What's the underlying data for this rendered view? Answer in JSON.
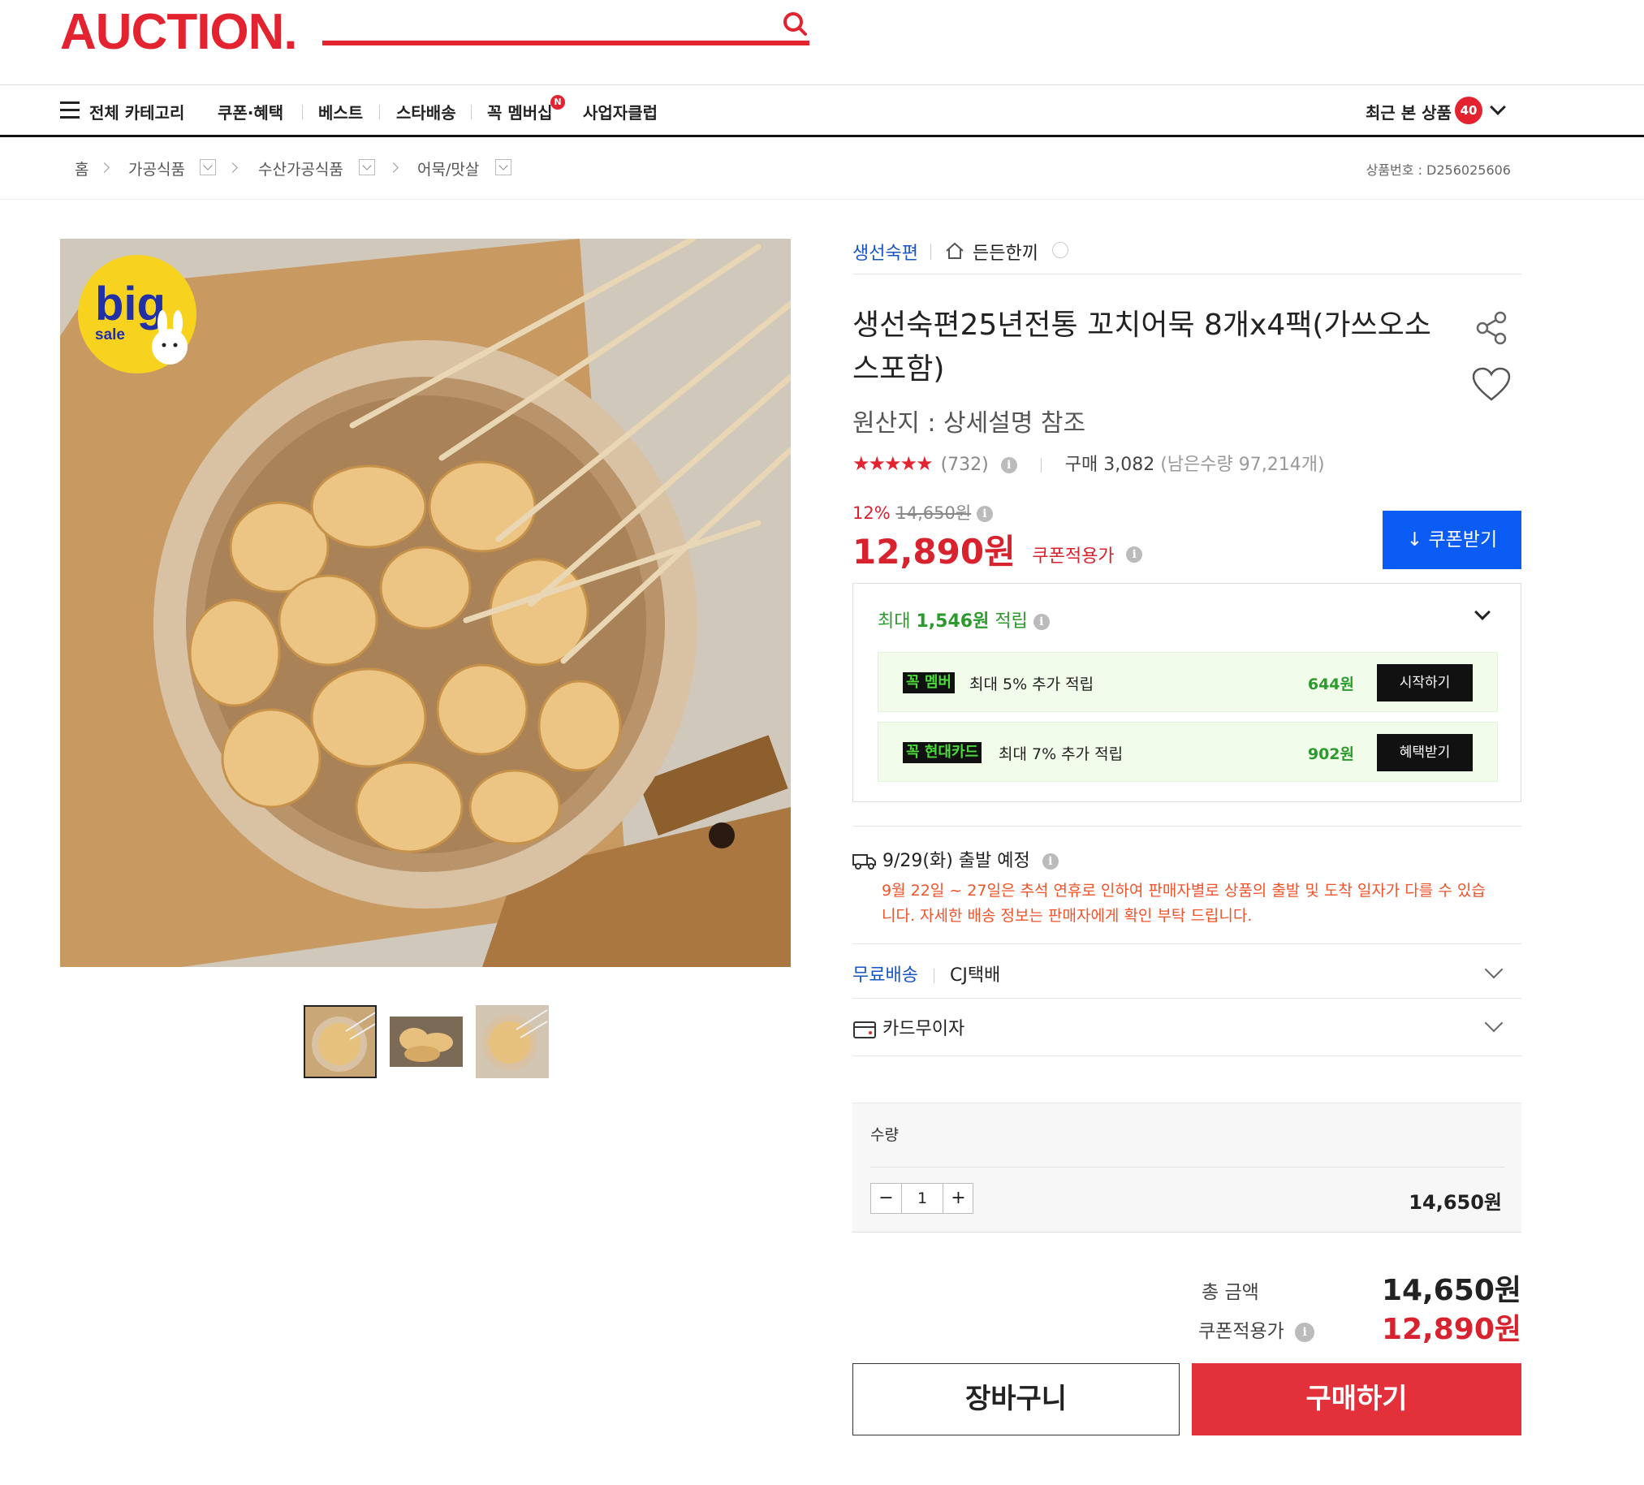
{
  "header": {
    "logo": "AUCTION."
  },
  "nav": {
    "all_categories": "전체 카테고리",
    "items": [
      "쿠폰·혜택",
      "베스트",
      "스타배송",
      "꼭 멤버십",
      "사업자클럽"
    ],
    "new_badge": "N",
    "recent_label": "최근 본 상품",
    "recent_count": "40"
  },
  "breadcrumb": {
    "items": [
      "홈",
      "가공식품",
      "수산가공식품",
      "어묵/맛살"
    ],
    "product_no": "상품번호 : D256025606"
  },
  "badge": {
    "big": "big",
    "sale": "sale"
  },
  "product": {
    "brand": "생선숙편",
    "store": "든든한끼",
    "title": "생선숙편25년전통 꼬치어묵 8개x4팩(가쓰오소스포함)",
    "origin": "원산지 : 상세설명 참조",
    "stars": "★★★★★",
    "rating_value": 4.5,
    "review_count": "(732)",
    "purchase": "구매 3,082",
    "stock": "(남은수량 97,214개)",
    "discount_rate": "12%",
    "original_price": "14,650원",
    "sale_price": "12,890원",
    "sale_price_label": "쿠폰적용가",
    "coupon_button": "쿠폰받기"
  },
  "rewards": {
    "max_prefix": "최대",
    "max_amount": "1,546원",
    "max_suffix": "적립",
    "items": [
      {
        "tag_a": "꼭",
        "tag_b": "멤버",
        "text": "최대 5% 추가 적립",
        "amount": "644원",
        "button": "시작하기"
      },
      {
        "tag_a": "꼭",
        "tag_b": "현대카드",
        "text": "최대 7% 추가 적립",
        "amount": "902원",
        "button": "혜택받기"
      }
    ]
  },
  "shipping": {
    "date": "9/29(화) 출발 예정",
    "notice": "9월 22일 ~ 27일은 추석 연휴로 인하여 판매자별로 상품의 출발 및 도착 일자가 다를 수 있습니다. 자세한 배송 정보는 판매자에게 확인 부탁 드립니다.",
    "free_label": "무료배송",
    "carrier": "CJ택배",
    "card_label": "카드무이자"
  },
  "quantity": {
    "label": "수량",
    "minus": "−",
    "value": "1",
    "plus": "+",
    "line_price": "14,650원"
  },
  "totals": {
    "total_label": "총 금액",
    "total_value": "14,650원",
    "coupon_label": "쿠폰적용가",
    "coupon_value": "12,890원"
  },
  "actions": {
    "cart": "장바구니",
    "buy": "구매하기"
  },
  "colors": {
    "brand_red": "#e3232f",
    "coupon_blue": "#0b5cf5",
    "reward_green": "#2c9a2c"
  }
}
